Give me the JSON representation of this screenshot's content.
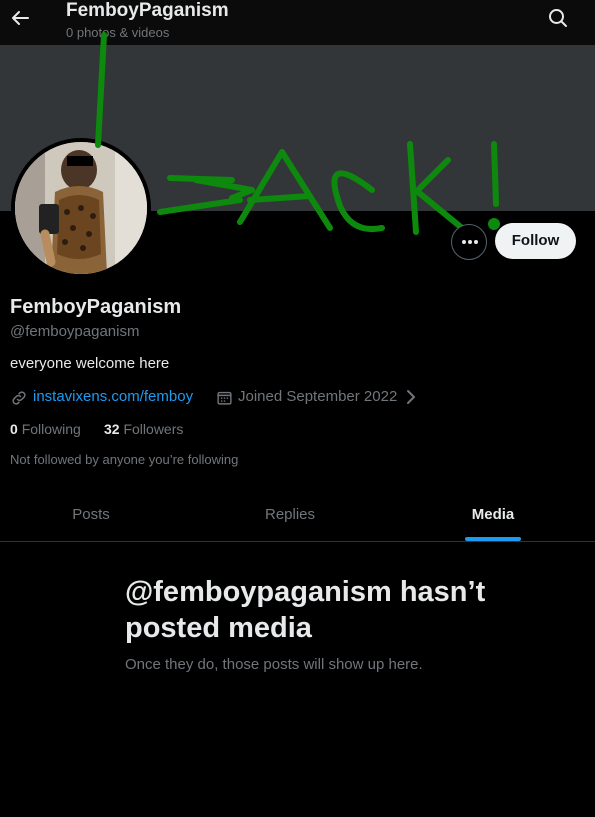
{
  "header": {
    "title": "FemboyPaganism",
    "subtitle": "0 photos & videos",
    "back_icon": "arrow-left-icon",
    "search_icon": "search-icon"
  },
  "graffiti": {
    "text": "JACK!",
    "color": "#0d8a0d"
  },
  "profile": {
    "display_name": "FemboyPaganism",
    "handle": "@femboypaganism",
    "bio": "everyone welcome here",
    "link": "instavixens.com/femboy",
    "joined": "Joined September 2022",
    "following_count": "0",
    "following_label": "Following",
    "followers_count": "32",
    "followers_label": "Followers",
    "followed_by_note": "Not followed by anyone you’re following"
  },
  "actions": {
    "more_icon": "more-horizontal-icon",
    "follow_label": "Follow"
  },
  "tabs": [
    {
      "label": "Posts",
      "active": false
    },
    {
      "label": "Replies",
      "active": false
    },
    {
      "label": "Media",
      "active": true
    }
  ],
  "empty_state": {
    "title": "@femboypaganism hasn’t posted media",
    "subtitle": "Once they do, those posts will show up here."
  },
  "colors": {
    "accent": "#1d9bf0",
    "background": "#000000",
    "muted_text": "#71767b",
    "primary_text": "#e7e9ea"
  }
}
